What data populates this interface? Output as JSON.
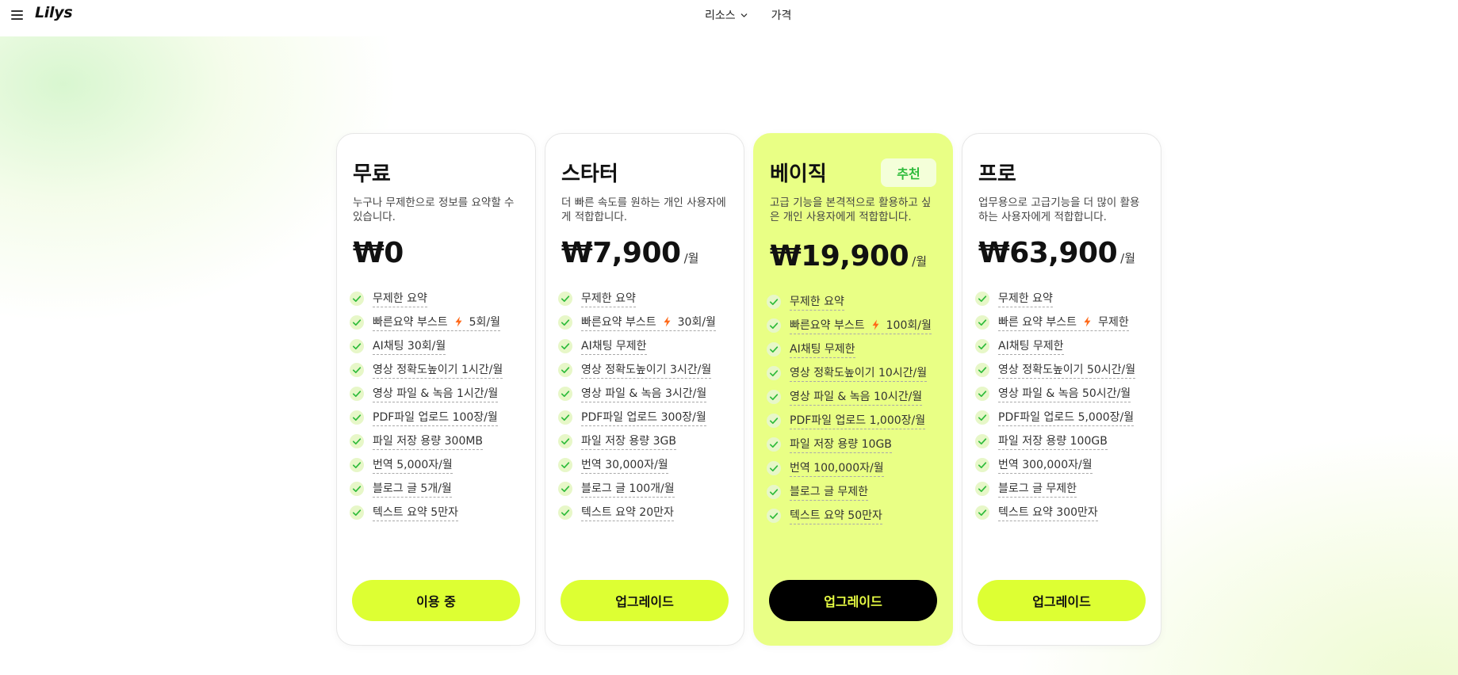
{
  "nav": {
    "logo": "Lilys",
    "links": [
      {
        "label": "리소스"
      },
      {
        "label": "가격"
      }
    ]
  },
  "colors": {
    "accent": "#ddff33",
    "featured_bg": "#e9ff85",
    "check": "#2dbb3a",
    "boost": "#ff6a1a",
    "badge_text": "#2dbb3a"
  },
  "plans": [
    {
      "name": "무료",
      "desc": "누구나 무제한으로 정보를 요약할 수 있습니다.",
      "price": "₩0",
      "period": "",
      "badge": "",
      "cta": "이용 중",
      "features": [
        {
          "pre": "무제한 요약",
          "post": ""
        },
        {
          "pre": "빠른요약 부스트",
          "post": "5회/월",
          "icon": "lightning-icon"
        },
        {
          "pre": "AI채팅 30회/월",
          "post": ""
        },
        {
          "pre": "영상 정확도높이기 1시간/월",
          "post": ""
        },
        {
          "pre": "영상 파일 & 녹음 1시간/월",
          "post": ""
        },
        {
          "pre": "PDF파일 업로드 100장/월",
          "post": ""
        },
        {
          "pre": "파일 저장 용량 300MB",
          "post": ""
        },
        {
          "pre": "번역 5,000자/월",
          "post": ""
        },
        {
          "pre": "블로그 글 5개/월",
          "post": ""
        },
        {
          "pre": "텍스트 요약 5만자",
          "post": ""
        }
      ]
    },
    {
      "name": "스타터",
      "desc": "더 빠른 속도를 원하는 개인 사용자에게 적합합니다.",
      "price": "₩7,900",
      "period": "/월",
      "badge": "",
      "cta": "업그레이드",
      "features": [
        {
          "pre": "무제한 요약",
          "post": ""
        },
        {
          "pre": "빠른요약 부스트",
          "post": "30회/월",
          "icon": "lightning-icon"
        },
        {
          "pre": "AI채팅 무제한",
          "post": ""
        },
        {
          "pre": "영상 정확도높이기 3시간/월",
          "post": ""
        },
        {
          "pre": "영상 파일 & 녹음 3시간/월",
          "post": ""
        },
        {
          "pre": "PDF파일 업로드 300장/월",
          "post": ""
        },
        {
          "pre": "파일 저장 용량 3GB",
          "post": ""
        },
        {
          "pre": "번역 30,000자/월",
          "post": ""
        },
        {
          "pre": "블로그 글 100개/월",
          "post": ""
        },
        {
          "pre": "텍스트 요약 20만자",
          "post": ""
        }
      ]
    },
    {
      "name": "베이직",
      "desc": "고급 기능을 본격적으로 활용하고 싶은 개인 사용자에게 적합합니다.",
      "price": "₩19,900",
      "period": "/월",
      "badge": "추천",
      "cta": "업그레이드",
      "features": [
        {
          "pre": "무제한 요약",
          "post": ""
        },
        {
          "pre": "빠른요약 부스트",
          "post": "100회/월",
          "icon": "lightning-icon"
        },
        {
          "pre": "AI채팅 무제한",
          "post": ""
        },
        {
          "pre": "영상 정확도높이기 10시간/월",
          "post": ""
        },
        {
          "pre": "영상 파일 & 녹음 10시간/월",
          "post": ""
        },
        {
          "pre": "PDF파일 업로드 1,000장/월",
          "post": ""
        },
        {
          "pre": "파일 저장 용량 10GB",
          "post": ""
        },
        {
          "pre": "번역 100,000자/월",
          "post": ""
        },
        {
          "pre": "블로그 글 무제한",
          "post": ""
        },
        {
          "pre": "텍스트 요약 50만자",
          "post": ""
        }
      ]
    },
    {
      "name": "프로",
      "desc": "업무용으로 고급기능을 더 많이 활용하는 사용자에게 적합합니다.",
      "price": "₩63,900",
      "period": "/월",
      "badge": "",
      "cta": "업그레이드",
      "features": [
        {
          "pre": "무제한 요약",
          "post": ""
        },
        {
          "pre": "빠른 요약 부스트",
          "post": "무제한",
          "icon": "lightning-icon"
        },
        {
          "pre": "AI채팅 무제한",
          "post": ""
        },
        {
          "pre": "영상 정확도높이기 50시간/월",
          "post": ""
        },
        {
          "pre": "영상 파일 & 녹음 50시간/월",
          "post": ""
        },
        {
          "pre": "PDF파일 업로드 5,000장/월",
          "post": ""
        },
        {
          "pre": "파일 저장 용량 100GB",
          "post": ""
        },
        {
          "pre": "번역 300,000자/월",
          "post": ""
        },
        {
          "pre": "블로그 글 무제한",
          "post": ""
        },
        {
          "pre": "텍스트 요약 300만자",
          "post": ""
        }
      ]
    }
  ]
}
